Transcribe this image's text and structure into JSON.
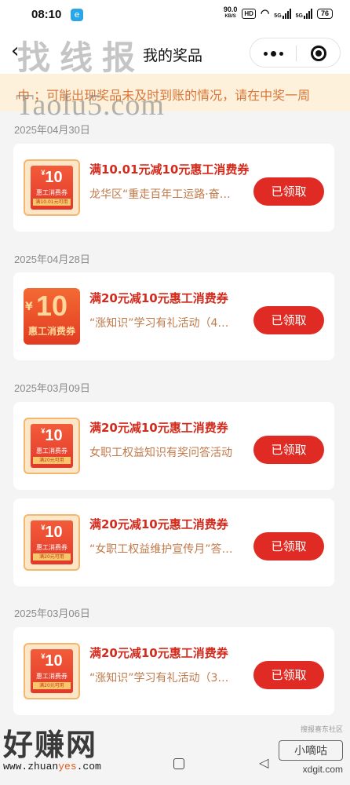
{
  "status_bar": {
    "time": "08:10",
    "net_speed_value": "90.0",
    "net_speed_unit": "KB/S",
    "hd_badge": "HD",
    "network_1": "5G",
    "network_2": "5G",
    "battery": "76"
  },
  "nav": {
    "title": "我的奖品",
    "watermark": "找线报"
  },
  "notice": {
    "text": "巾 ；可能出现奖品未及时到账的情况，请在中奖一周"
  },
  "watermarks": {
    "mid": "Taolu5.com",
    "bottom_big": "好赚网",
    "bottom_url_1": "www.zhuan",
    "bottom_url_2": "yes",
    "bottom_url_3": ".com",
    "bottom_small": "搜报喜东社区",
    "bottom_xiao": "小嘀咕",
    "bottom_xdg": "xdgit.com"
  },
  "colors": {
    "accent_red": "#e02b24",
    "notice_bg": "#fdf1dc",
    "notice_text": "#d9773a"
  },
  "dates": [
    "2025年04月30日",
    "2025年04月28日",
    "2025年03月09日",
    "2025年03月06日"
  ],
  "prizes": [
    {
      "title": "满10.01元减10元惠工消费券",
      "desc": "龙华区“重走百年工运路·奋…",
      "button": "已领取",
      "coupon": {
        "amount": "10",
        "currency": "¥",
        "label": "惠工消费券",
        "strip": "满10.01元可用"
      }
    },
    {
      "title": "满20元减10元惠工消费券",
      "desc": "“涨知识”学习有礼活动（4…",
      "button": "已领取",
      "coupon": {
        "amount": "10",
        "currency": "¥",
        "label": "惠工消费券"
      }
    },
    {
      "title": "满20元减10元惠工消费券",
      "desc": "女职工权益知识有奖问答活动",
      "button": "已领取",
      "coupon": {
        "amount": "10",
        "currency": "¥",
        "label": "惠工消费券",
        "strip": "满20元可用"
      }
    },
    {
      "title": "满20元减10元惠工消费券",
      "desc": "“女职工权益维护宣传月”答…",
      "button": "已领取",
      "coupon": {
        "amount": "10",
        "currency": "¥",
        "label": "惠工消费券",
        "strip": "满20元可用"
      }
    },
    {
      "title": "满20元减10元惠工消费券",
      "desc": "“涨知识”学习有礼活动（3…",
      "button": "已领取",
      "coupon": {
        "amount": "10",
        "currency": "¥",
        "label": "惠工消费券",
        "strip": "满20元可用"
      }
    }
  ]
}
